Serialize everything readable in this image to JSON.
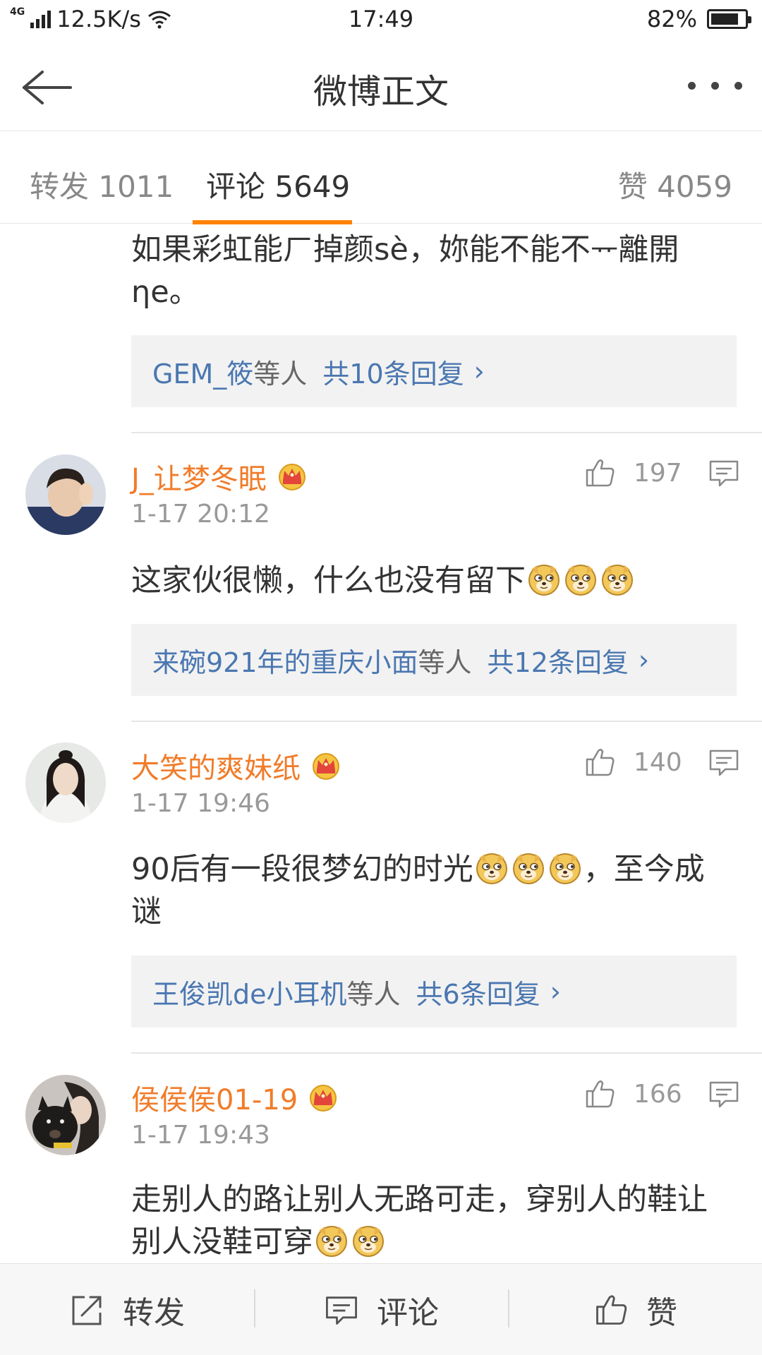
{
  "status_bar": {
    "network": "4G",
    "speed": "12.5K/s",
    "time": "17:49",
    "battery": "82%",
    "battery_level": 0.82
  },
  "header": {
    "title": "微博正文"
  },
  "tabs": {
    "repost": "转发 1011",
    "comment": "评论 5649",
    "like": "赞 4059"
  },
  "partial_comment": {
    "text": "如果彩虹能ㄏ掉颜sè，妳能不能不ᅲ離開ηe。",
    "reply_names": "GEM_筱",
    "reply_others": "等人",
    "reply_count": "共10条回复",
    "chevron": "›"
  },
  "comments": [
    {
      "username": "J_让梦冬眠",
      "time": "1-17 20:12",
      "likes": "197",
      "text": "这家伙很懒，什么也没有留下",
      "emoji_count": 3,
      "reply_names": "来碗921年的重庆小面",
      "reply_others": "等人",
      "reply_count": "共12条回复",
      "chevron": "›"
    },
    {
      "username": "大笑的爽妹纸",
      "time": "1-17 19:46",
      "likes": "140",
      "text_before": "90后有一段很梦幻的时光",
      "text_after": "，至今成",
      "text_line2": "谜",
      "emoji_count": 3,
      "reply_names": "王俊凯de小耳机",
      "reply_others": "等人",
      "reply_count": "共6条回复",
      "chevron": "›"
    },
    {
      "username": "侯侯侯01-19",
      "time": "1-17 19:43",
      "likes": "166",
      "text_line1": "走别人的路让别人无路可走，穿别人的鞋让",
      "text_line2": "别人没鞋可穿",
      "emoji_count": 2
    }
  ],
  "bottom_bar": {
    "repost": "转发",
    "comment": "评论",
    "like": "赞"
  },
  "icons": {
    "accent": "#ff8200",
    "username_color": "#f07c2a",
    "link_color": "#4a77b1"
  }
}
